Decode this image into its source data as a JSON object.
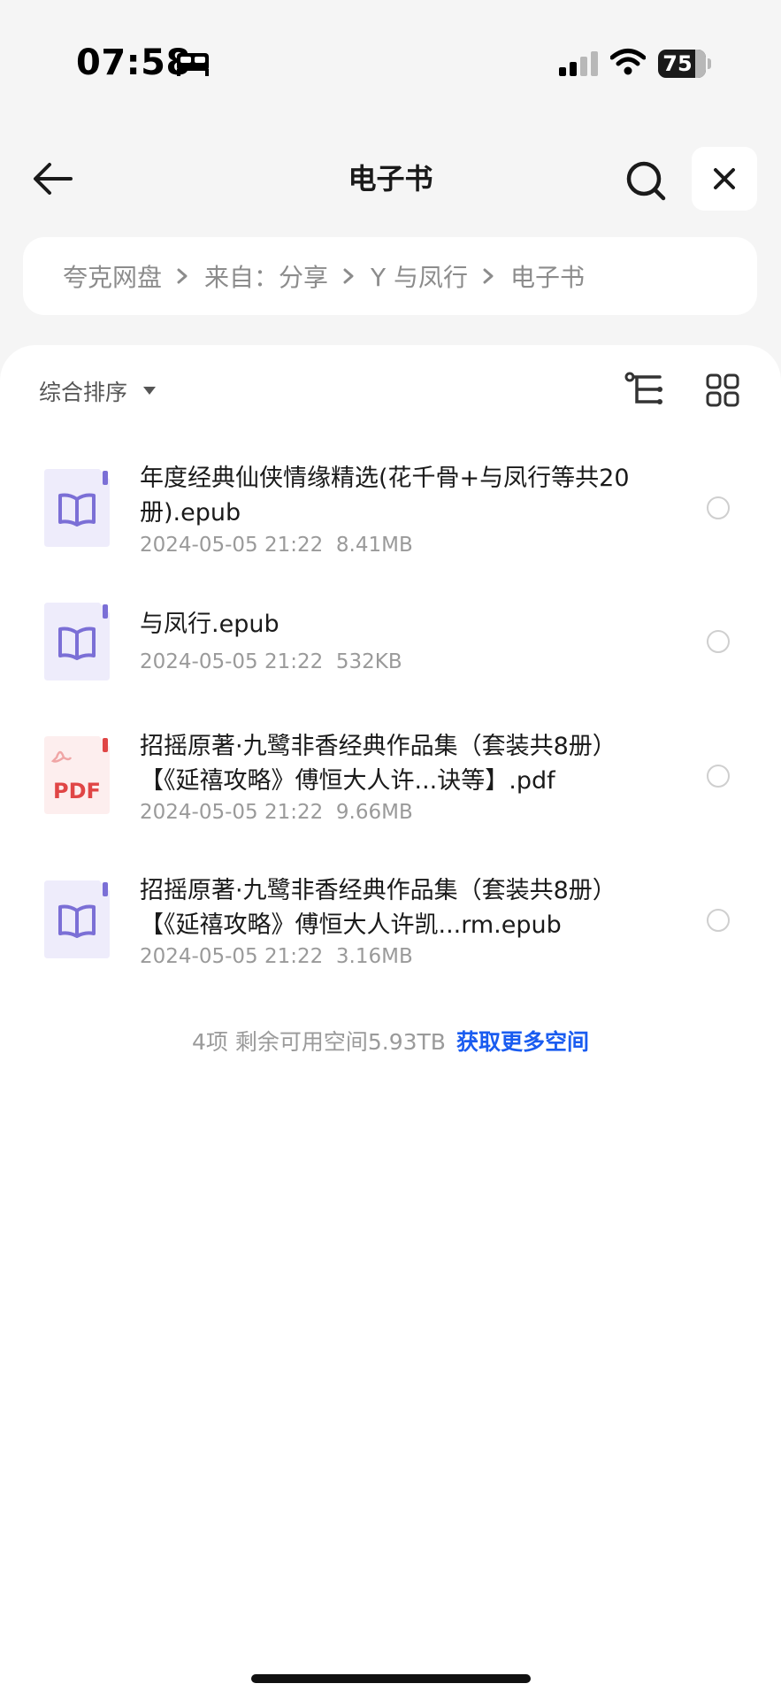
{
  "status_bar": {
    "time": "07:58",
    "battery": "75"
  },
  "header": {
    "title": "电子书"
  },
  "breadcrumb": [
    "夸克网盘",
    "来自：分享",
    "Y 与凤行",
    "电子书"
  ],
  "toolbar": {
    "sort_label": "综合排序"
  },
  "files": [
    {
      "name": "年度经典仙侠情缘精选(花千骨+与凤行等共20册).epub",
      "date": "2024-05-05 21:22",
      "size": "8.41MB",
      "type": "epub"
    },
    {
      "name": "与凤行.epub",
      "date": "2024-05-05 21:22",
      "size": "532KB",
      "type": "epub"
    },
    {
      "name": "招摇原著·九鹭非香经典作品集（套装共8册）【《延禧攻略》傅恒大人许...诀等】.pdf",
      "date": "2024-05-05 21:22",
      "size": "9.66MB",
      "type": "pdf"
    },
    {
      "name": "招摇原著·九鹭非香经典作品集（套装共8册）【《延禧攻略》傅恒大人许凯...rm.epub",
      "date": "2024-05-05 21:22",
      "size": "3.16MB",
      "type": "epub"
    }
  ],
  "footer": {
    "summary": "4项 剩余可用空间5.93TB",
    "link": "获取更多空间"
  },
  "colors": {
    "accent": "#1a5cf0",
    "epub_icon": "#7b6fd6",
    "pdf_icon": "#e04646"
  }
}
